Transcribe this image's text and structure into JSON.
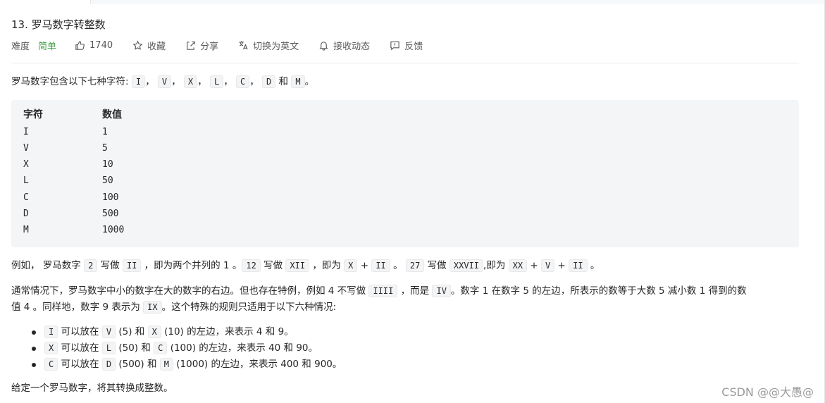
{
  "problem": {
    "title": "13. 罗马数字转整数",
    "difficulty_label": "难度",
    "difficulty": "简单",
    "likes": "1740",
    "favorite": "收藏",
    "share": "分享",
    "switch_lang": "切换为英文",
    "notify": "接收动态",
    "feedback": "反馈"
  },
  "intro": {
    "text": "罗马数字包含以下七种字符:",
    "chars": [
      "I",
      "V",
      "X",
      "L",
      "C",
      "D",
      "M"
    ],
    "sep": "，",
    "and": "和",
    "end": "。"
  },
  "table": {
    "headers": [
      "字符",
      "数值"
    ],
    "rows": [
      [
        "I",
        "1"
      ],
      [
        "V",
        "5"
      ],
      [
        "X",
        "10"
      ],
      [
        "L",
        "50"
      ],
      [
        "C",
        "100"
      ],
      [
        "D",
        "500"
      ],
      [
        "M",
        "1000"
      ]
    ]
  },
  "example": {
    "t1": "例如， 罗马数字",
    "c1": "2",
    "t2": "写做",
    "c2": "II",
    "t3": "，即为两个并列的 1 。",
    "c3": "12",
    "t4": "写做",
    "c4": "XII",
    "t5": "，即为",
    "c5": "X",
    "plus": "+",
    "c6": "II",
    "t6": "。",
    "c7": "27",
    "t7": "写做",
    "c8": "XXVII",
    "t8": ",即为",
    "c9": "XX",
    "c10": "V",
    "c11": "II",
    "t9": "。"
  },
  "special": {
    "t1": "通常情况下，罗马数字中小的数字在大的数字的右边。但也存在特例，例如 4 不写做",
    "c1": "IIII",
    "t2": "，而是",
    "c2": "IV",
    "t3": "。数字 1 在数字 5 的左边，所表示的数等于大数 5 减小数 1 得到的数",
    "t4": "值 4 。同样地，数字 9 表示为",
    "c3": "IX",
    "t5": "。这个特殊的规则只适用于以下六种情况:"
  },
  "rules": [
    {
      "a": "I",
      "t1": "可以放在",
      "b": "V",
      "t2": "(5) 和",
      "c": "X",
      "t3": "(10) 的左边，来表示 4 和 9。"
    },
    {
      "a": "X",
      "t1": "可以放在",
      "b": "L",
      "t2": "(50) 和",
      "c": "C",
      "t3": "(100) 的左边，来表示 40 和 90。"
    },
    {
      "a": "C",
      "t1": "可以放在",
      "b": "D",
      "t2": "(500) 和",
      "c": "M",
      "t3": "(1000) 的左边，来表示 400 和 900。"
    }
  ],
  "closing": "给定一个罗马数字，将其转换成整数。",
  "watermark": "CSDN @@大愚@",
  "colors": {
    "difficulty_easy": "#43a047",
    "code_bg": "#f3f4f6",
    "block_bg": "#f4f5f7"
  }
}
